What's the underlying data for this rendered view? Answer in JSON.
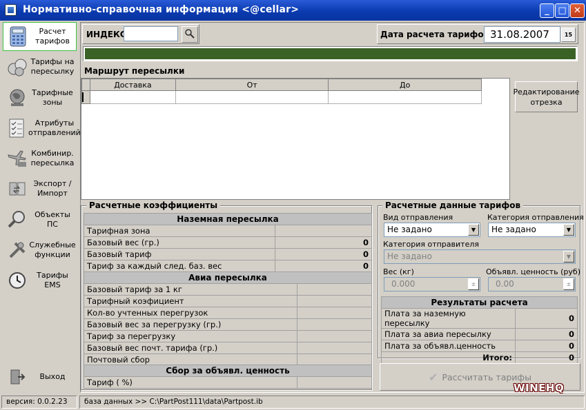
{
  "window": {
    "title": "Нормативно-справочная информация <@cellar>",
    "controls": {
      "minimize": "_",
      "maximize": "□",
      "close": "✕"
    }
  },
  "sidebar": {
    "items": [
      {
        "label": "Расчет тарифов",
        "icon": "calculator-icon"
      },
      {
        "label": "Тарифы на пересылку",
        "icon": "coins-icon"
      },
      {
        "label": "Тарифные зоны",
        "icon": "globe-icon"
      },
      {
        "label": "Атрибуты отправлений",
        "icon": "checklist-icon"
      },
      {
        "label": "Комбинир. пересылка",
        "icon": "plane-truck-icon"
      },
      {
        "label": "Экспорт / Импорт",
        "icon": "export-import-icon"
      },
      {
        "label": "Объекты ПС",
        "icon": "magnifier-icon"
      },
      {
        "label": "Служебные функции",
        "icon": "tools-icon"
      },
      {
        "label": "Тарифы EMS",
        "icon": "clock-icon"
      }
    ],
    "exit_label": "Выход"
  },
  "toolbar": {
    "index_label": "ИНДЕКС",
    "index_value": "",
    "date_label": "Дата расчета тарифов",
    "date_value": "31.08.2007",
    "calendar_icon_text": "15"
  },
  "route": {
    "title": "Маршрут пересылки",
    "columns": [
      "Доставка",
      "От",
      "До"
    ],
    "edit_button": "Редактирование отрезка"
  },
  "coefficients": {
    "legend": "Расчетные коэффициенты",
    "ground": {
      "header": "Наземная пересылка",
      "rows": [
        {
          "label": "Тарифная зона",
          "value": ""
        },
        {
          "label": "Базовый вес (гр.)",
          "value": "0"
        },
        {
          "label": "Базовый тариф",
          "value": "0"
        },
        {
          "label": "Тариф за каждый след. баз. вес",
          "value": "0"
        }
      ]
    },
    "air": {
      "header": "Авиа пересылка",
      "rows": [
        {
          "label": "Базовый тариф за 1 кг",
          "value": ""
        },
        {
          "label": "Тарифный коэфициент",
          "value": ""
        },
        {
          "label": "Кол-во учтенных перегрузок",
          "value": ""
        },
        {
          "label": "Базовый вес за  перегрузку (гр.)",
          "value": ""
        },
        {
          "label": "Тариф за  перегрузку",
          "value": ""
        },
        {
          "label": "Базовый вес почт. тарифа (гр.)",
          "value": ""
        },
        {
          "label": "Почтовый сбор",
          "value": ""
        }
      ]
    },
    "declared": {
      "header": "Сбор за объявл. ценность",
      "rows": [
        {
          "label": "Тариф ( %)",
          "value": ""
        }
      ]
    }
  },
  "tariffs": {
    "legend": "Расчетные данные тарифов",
    "shipment_type_label": "Вид отправления",
    "shipment_type_value": "Не задано",
    "shipment_category_label": "Категория отправления",
    "shipment_category_value": "Не задано",
    "sender_category_label": "Категория отправителя",
    "sender_category_value": "Не задано",
    "weight_label": "Вес (кг)",
    "weight_value": "0.000",
    "declared_value_label": "Объявл. ценность (руб)",
    "declared_value_value": "0.00",
    "results": {
      "header": "Результаты расчета",
      "rows": [
        {
          "label": "Плата за наземную пересылку",
          "value": "0"
        },
        {
          "label": "Плата за авиа пересылку",
          "value": "0"
        },
        {
          "label": "Плата за объявл.ценность",
          "value": "0"
        }
      ],
      "total_label": "Итого:",
      "total_value": "0"
    },
    "calculate_button": "Рассчитать тарифы"
  },
  "statusbar": {
    "version": "версия: 0.0.2.23",
    "database": "база данных >> C:\\PartPost111\\data\\Partpost.ib"
  },
  "watermark": "WINEHQ"
}
